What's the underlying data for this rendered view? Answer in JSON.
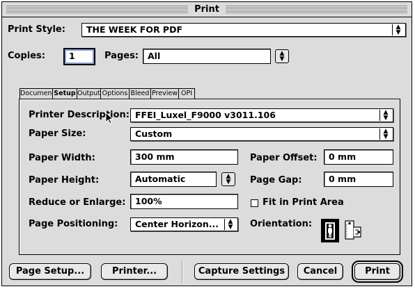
{
  "window": {
    "title": "Print"
  },
  "print_style": {
    "label": "Print Style:",
    "value": "THE WEEK FOR PDF"
  },
  "copies": {
    "label": "Copies:",
    "value": "1"
  },
  "pages": {
    "label": "Pages:",
    "value": "All"
  },
  "tabs": [
    {
      "label": "Document",
      "active": false
    },
    {
      "label": "Setup",
      "active": true
    },
    {
      "label": "Output",
      "active": false
    },
    {
      "label": "Options",
      "active": false
    },
    {
      "label": "Bleed",
      "active": false
    },
    {
      "label": "Preview",
      "active": false
    },
    {
      "label": "OPI",
      "active": false
    }
  ],
  "setup": {
    "printer_description": {
      "label": "Printer Description:",
      "value": "FFEI_Luxel_F9000 v3011.106"
    },
    "paper_size": {
      "label": "Paper Size:",
      "value": "Custom"
    },
    "paper_width": {
      "label": "Paper Width:",
      "value": "300  mm"
    },
    "paper_offset": {
      "label": "Paper Offset:",
      "value": "0  mm"
    },
    "paper_height": {
      "label": "Paper Height:",
      "value": "Automatic"
    },
    "page_gap": {
      "label": "Page Gap:",
      "value": "0  mm"
    },
    "reduce_enlarge": {
      "label": "Reduce or Enlarge:",
      "value": "100%"
    },
    "fit_in_print_area": {
      "label": "Fit in Print Area",
      "checked": false
    },
    "page_positioning": {
      "label": "Page Positioning:",
      "value": "Center Horizon..."
    },
    "orientation": {
      "label": "Orientation:",
      "selected": "portrait"
    }
  },
  "buttons": {
    "page_setup": "Page Setup...",
    "printer": "Printer...",
    "capture_settings": "Capture Settings",
    "cancel": "Cancel",
    "print": "Print"
  }
}
